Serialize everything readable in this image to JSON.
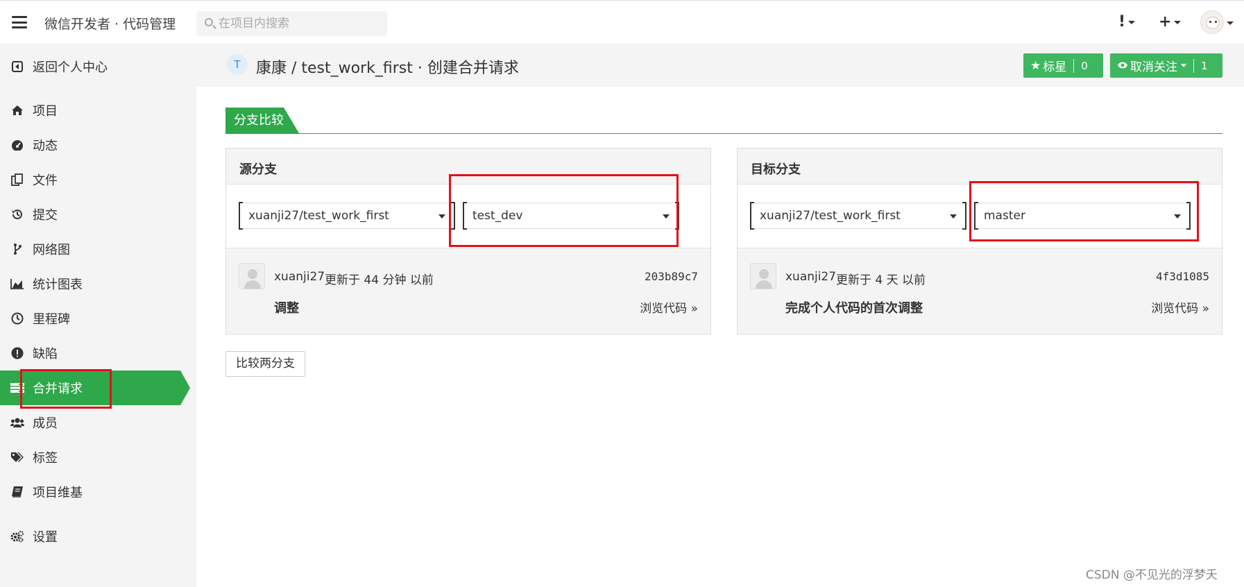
{
  "topbar": {
    "app_title": "微信开发者 · 代码管理",
    "search_placeholder": "在项目内搜索",
    "alert_label": "!",
    "add_label": "+"
  },
  "sidebar": {
    "back_label": "返回个人中心",
    "items": [
      {
        "label": "项目",
        "icon": "home-icon"
      },
      {
        "label": "动态",
        "icon": "dashboard-icon"
      },
      {
        "label": "文件",
        "icon": "files-icon"
      },
      {
        "label": "提交",
        "icon": "history-icon"
      },
      {
        "label": "网络图",
        "icon": "branch-icon"
      },
      {
        "label": "统计图表",
        "icon": "area-chart-icon"
      },
      {
        "label": "里程碑",
        "icon": "clock-icon"
      },
      {
        "label": "缺陷",
        "icon": "exclamation-icon"
      },
      {
        "label": "合并请求",
        "icon": "merge-request-icon",
        "active": true
      },
      {
        "label": "成员",
        "icon": "users-icon"
      },
      {
        "label": "标签",
        "icon": "tags-icon"
      },
      {
        "label": "项目维基",
        "icon": "book-icon"
      }
    ],
    "settings_label": "设置"
  },
  "project": {
    "badge": "T",
    "title": "康康 / test_work_first · 创建合并请求",
    "star_label": "标星",
    "star_count": "0",
    "watch_label": "取消关注",
    "watch_count": "1"
  },
  "section_tab": "分支比较",
  "source": {
    "heading": "源分支",
    "repo": "xuanji27/test_work_first",
    "branch": "test_dev",
    "author": "xuanji27",
    "updated": "更新于 44 分钟 以前",
    "hash": "203b89c7",
    "message": "调整",
    "browse": "浏览代码 »"
  },
  "target": {
    "heading": "目标分支",
    "repo": "xuanji27/test_work_first",
    "branch": "master",
    "author": "xuanji27",
    "updated": "更新于 4 天 以前",
    "hash": "4f3d1085",
    "message": "完成个人代码的首次调整",
    "browse": "浏览代码 »"
  },
  "compare_button": "比较两分支",
  "watermark": "CSDN @不见光的浮梦夭",
  "colors": {
    "accent": "#2ea84a",
    "button_green": "#3fb660",
    "annotation_red": "#e3101a"
  }
}
